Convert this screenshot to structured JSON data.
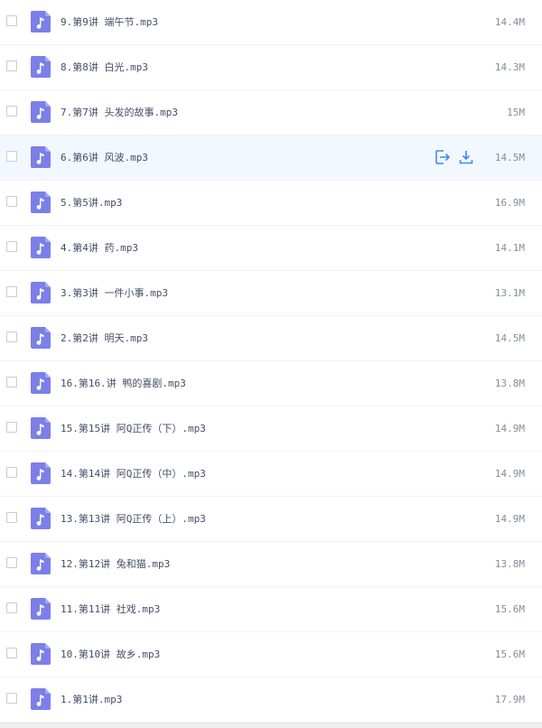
{
  "files": [
    {
      "name": "9.第9讲 端午节.mp3",
      "size": "14.4M",
      "icon": "music-file-icon"
    },
    {
      "name": "8.第8讲 白光.mp3",
      "size": "14.3M",
      "icon": "music-file-icon"
    },
    {
      "name": "7.第7讲 头发的故事.mp3",
      "size": "15M",
      "icon": "music-file-icon"
    },
    {
      "name": "6.第6讲 风波.mp3",
      "size": "14.5M",
      "icon": "music-file-icon",
      "hovered": true,
      "actions": [
        "share-icon",
        "download-icon"
      ]
    },
    {
      "name": "5.第5讲.mp3",
      "size": "16.9M",
      "icon": "music-file-icon"
    },
    {
      "name": "4.第4讲 药.mp3",
      "size": "14.1M",
      "icon": "music-file-icon"
    },
    {
      "name": "3.第3讲 一件小事.mp3",
      "size": "13.1M",
      "icon": "music-file-icon"
    },
    {
      "name": "2.第2讲 明天.mp3",
      "size": "14.5M",
      "icon": "music-file-icon"
    },
    {
      "name": "16.第16.讲 鸭的喜剧.mp3",
      "size": "13.8M",
      "icon": "music-file-icon"
    },
    {
      "name": "15.第15讲 阿Q正传（下）.mp3",
      "size": "14.9M",
      "icon": "music-file-icon"
    },
    {
      "name": "14.第14讲 阿Q正传（中）.mp3",
      "size": "14.9M",
      "icon": "music-file-icon"
    },
    {
      "name": "13.第13讲 阿Q正传（上）.mp3",
      "size": "14.9M",
      "icon": "music-file-icon"
    },
    {
      "name": "12.第12讲 兔和猫.mp3",
      "size": "13.8M",
      "icon": "music-file-icon"
    },
    {
      "name": "11.第11讲 社戏.mp3",
      "size": "15.6M",
      "icon": "music-file-icon"
    },
    {
      "name": "10.第10讲 故乡.mp3",
      "size": "15.6M",
      "icon": "music-file-icon"
    },
    {
      "name": "1.第1讲.mp3",
      "size": "17.9M",
      "icon": "music-file-icon"
    }
  ],
  "colors": {
    "icon_bg": "#7b7fe8",
    "icon_fold": "#a6a9f2",
    "hover_row_bg": "#f3f7ff",
    "action_blue": "#3b8cf0",
    "name_text": "#424e67",
    "size_text": "#878c9c"
  }
}
